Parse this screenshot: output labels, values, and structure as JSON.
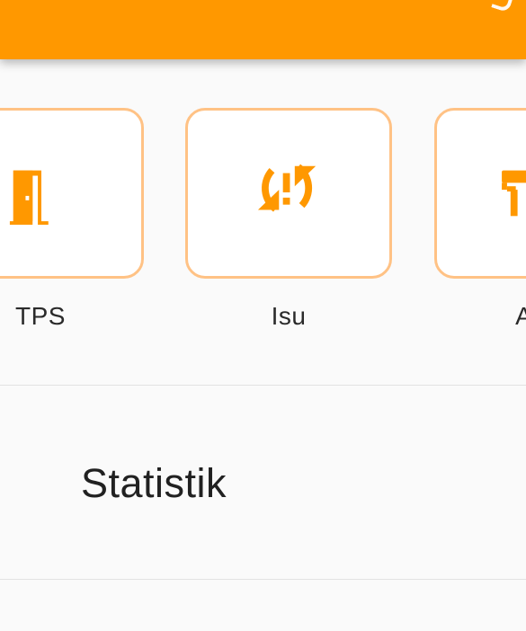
{
  "colors": {
    "primary": "#ff9800",
    "tile_border": "#ffc285",
    "icon": "#ff9800",
    "background": "#fafafa",
    "text": "#2a2a2a"
  },
  "menu": {
    "items": [
      {
        "label": "TPS",
        "icon": "door-icon"
      },
      {
        "label": "Isu",
        "icon": "sync-problem-icon"
      },
      {
        "label": "Asp",
        "icon": "paint-roller-icon"
      }
    ]
  },
  "section": {
    "title": "Statistik"
  }
}
